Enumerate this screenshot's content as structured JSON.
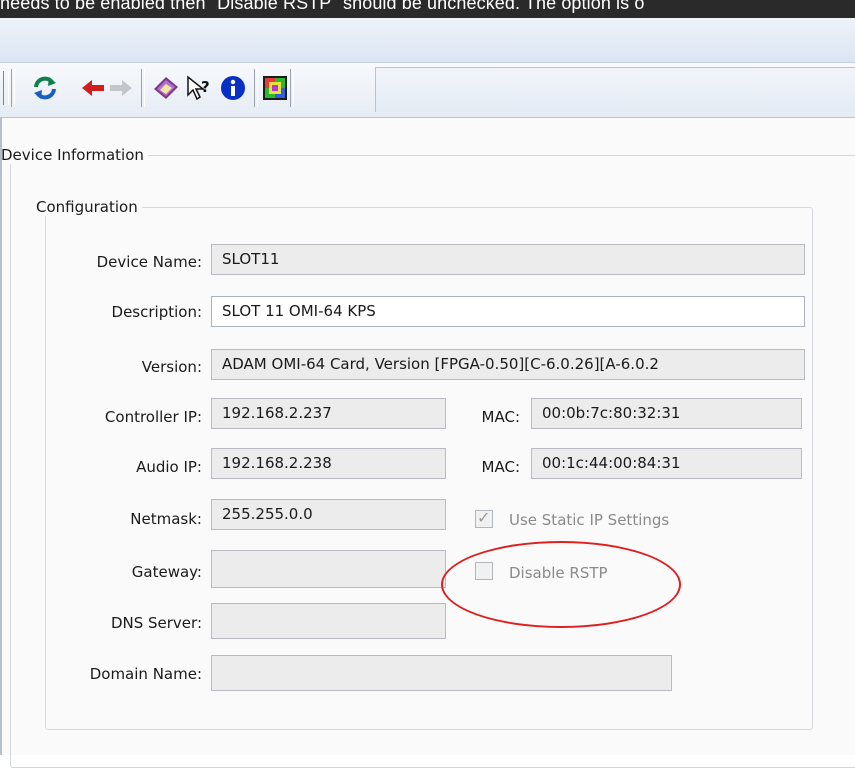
{
  "doc_text": "needs to be enabled then \"Disable RSTP\" should be unchecked. The option is o",
  "toolbar": {
    "icons": [
      "refresh-icon",
      "back-arrow-icon",
      "forward-arrow-icon",
      "book-icon",
      "help-pointer-icon",
      "info-icon",
      "color-grid-icon"
    ]
  },
  "device_info": {
    "legend": "Device Information",
    "configuration": {
      "legend": "Configuration",
      "device_name_label": "Device Name:",
      "device_name_value": "SLOT11",
      "description_label": "Description:",
      "description_value": "SLOT 11 OMI-64 KPS",
      "version_label": "Version:",
      "version_value": "ADAM OMI-64 Card, Version [FPGA-0.50][C-6.0.26][A-6.0.2",
      "controller_ip_label": "Controller IP:",
      "controller_ip_value": "192.168.2.237",
      "controller_mac_label": "MAC:",
      "controller_mac_value": "00:0b:7c:80:32:31",
      "audio_ip_label": "Audio IP:",
      "audio_ip_value": "192.168.2.238",
      "audio_mac_label": "MAC:",
      "audio_mac_value": "00:1c:44:00:84:31",
      "netmask_label": "Netmask:",
      "netmask_value": "255.255.0.0",
      "static_ip_label": "Use Static IP Settings",
      "static_ip_checked": true,
      "gateway_label": "Gateway:",
      "gateway_value": "",
      "disable_rstp_label": "Disable RSTP",
      "disable_rstp_checked": false,
      "dns_label": "DNS Server:",
      "dns_value": "",
      "domain_label": "Domain Name:",
      "domain_value": ""
    }
  },
  "colors": {
    "annotation_circle": "#dd1f1f"
  }
}
